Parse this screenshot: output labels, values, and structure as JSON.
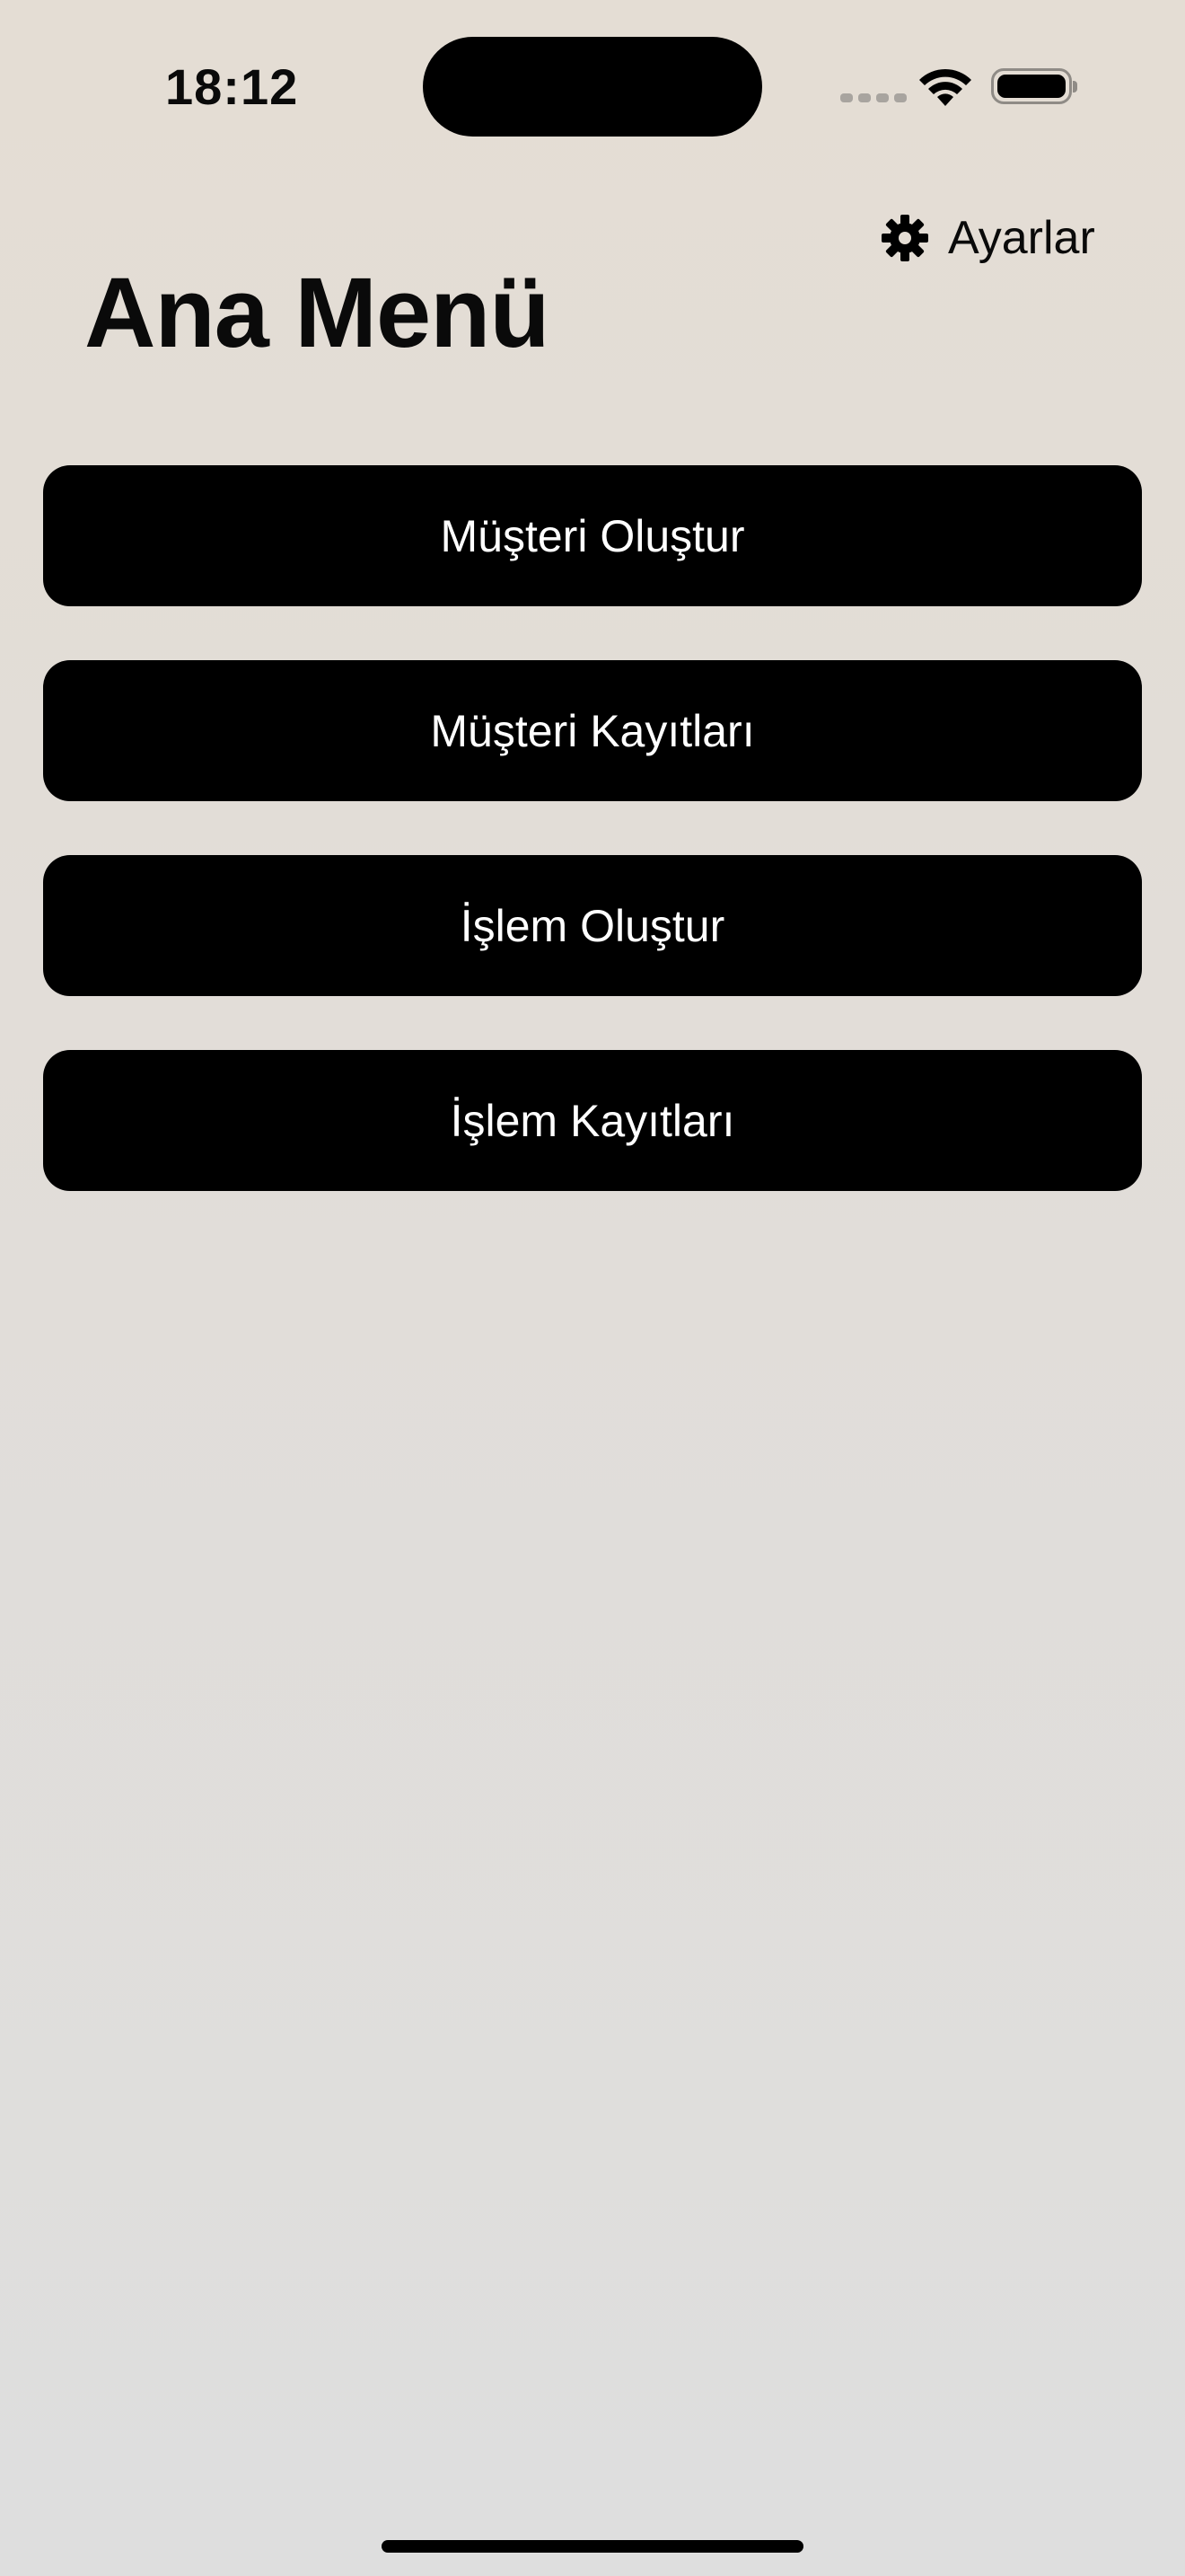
{
  "status_bar": {
    "time": "18:12"
  },
  "header": {
    "settings_label": "Ayarlar",
    "title": "Ana Menü"
  },
  "menu": {
    "items": [
      {
        "label": "Müşteri Oluştur"
      },
      {
        "label": "Müşteri Kayıtları"
      },
      {
        "label": "İşlem Oluştur"
      },
      {
        "label": "İşlem Kayıtları"
      }
    ]
  },
  "icons": {
    "settings": "gear-icon",
    "wifi": "wifi-icon",
    "battery": "battery-icon",
    "signal": "cellular-signal-icon"
  },
  "colors": {
    "button_background": "#000000",
    "button_text": "#ffffff",
    "page_background_top": "#e4ddd4",
    "page_background_bottom": "#dedede"
  }
}
